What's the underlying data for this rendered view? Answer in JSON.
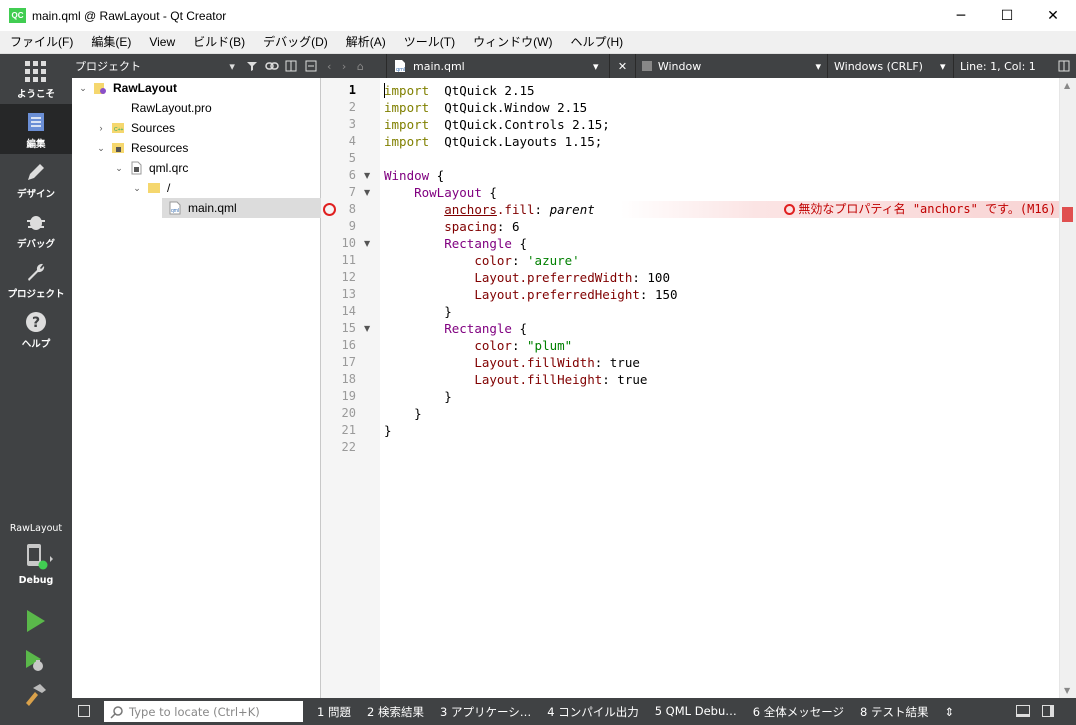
{
  "window": {
    "logo": "QC",
    "title": "main.qml @ RawLayout - Qt Creator",
    "controls": [
      "─",
      "☐",
      "✕"
    ]
  },
  "menu": [
    "ファイル(F)",
    "編集(E)",
    "View",
    "ビルド(B)",
    "デバッグ(D)",
    "解析(A)",
    "ツール(T)",
    "ウィンドウ(W)",
    "ヘルプ(H)"
  ],
  "modes": [
    {
      "label": "ようこそ",
      "icon": "grid-icon"
    },
    {
      "label": "編集",
      "icon": "document-icon",
      "active": true
    },
    {
      "label": "デザイン",
      "icon": "pen-icon"
    },
    {
      "label": "デバッグ",
      "icon": "bug-icon"
    },
    {
      "label": "プロジェクト",
      "icon": "wrench-icon"
    },
    {
      "label": "ヘルプ",
      "icon": "help-icon"
    }
  ],
  "kit": {
    "project": "RawLayout",
    "config": "Debug"
  },
  "project_panel": {
    "title": "プロジェクト"
  },
  "tree": [
    {
      "label": "RawLayout",
      "depth": 0,
      "arrow": "⌄",
      "icon": "project-icon",
      "bold": true
    },
    {
      "label": "RawLayout.pro",
      "depth": 1,
      "arrow": "",
      "icon": "pro-file-icon"
    },
    {
      "label": "Sources",
      "depth": 1,
      "arrow": "›",
      "icon": "sources-folder-icon"
    },
    {
      "label": "Resources",
      "depth": 1,
      "arrow": "⌄",
      "icon": "resources-folder-icon"
    },
    {
      "label": "qml.qrc",
      "depth": 2,
      "arrow": "⌄",
      "icon": "qrc-file-icon"
    },
    {
      "label": "/",
      "depth": 3,
      "arrow": "⌄",
      "icon": "folder-icon"
    },
    {
      "label": "main.qml",
      "depth": 4,
      "arrow": "",
      "icon": "qml-file-icon",
      "selected": true
    }
  ],
  "editor_header": {
    "file": "main.qml",
    "symbol": "Window",
    "line_ending": "Windows (CRLF)",
    "position": "Line: 1, Col: 1"
  },
  "editor": {
    "current_line": 1,
    "fold_lines": [
      6,
      7,
      10,
      15
    ],
    "error_line": 8,
    "error_message": "無効なプロパティ名 \"anchors\" です。(M16)",
    "lines": [
      [
        [
          "kw",
          "import"
        ],
        [
          "",
          "  QtQuick 2.15"
        ]
      ],
      [
        [
          "kw",
          "import"
        ],
        [
          "",
          "  QtQuick.Window 2.15"
        ]
      ],
      [
        [
          "kw",
          "import"
        ],
        [
          "",
          "  QtQuick.Controls 2.15;"
        ]
      ],
      [
        [
          "kw",
          "import"
        ],
        [
          "",
          "  QtQuick.Layouts 1.15;"
        ]
      ],
      [],
      [
        [
          "type",
          "Window"
        ],
        [
          "",
          " {"
        ]
      ],
      [
        [
          "",
          "    "
        ],
        [
          "type",
          "RowLayout"
        ],
        [
          "",
          " {"
        ]
      ],
      [
        [
          "",
          "        "
        ],
        [
          "prop-u",
          "anchors"
        ],
        [
          "prop",
          ".fill"
        ],
        [
          "",
          ": "
        ],
        [
          "it",
          "parent"
        ]
      ],
      [
        [
          "",
          "        "
        ],
        [
          "prop",
          "spacing"
        ],
        [
          "",
          ": 6"
        ]
      ],
      [
        [
          "",
          "        "
        ],
        [
          "type",
          "Rectangle"
        ],
        [
          "",
          " {"
        ]
      ],
      [
        [
          "",
          "            "
        ],
        [
          "prop",
          "color"
        ],
        [
          "",
          ": "
        ],
        [
          "str",
          "'azure'"
        ]
      ],
      [
        [
          "",
          "            "
        ],
        [
          "prop",
          "Layout.preferredWidth"
        ],
        [
          "",
          ": 100"
        ]
      ],
      [
        [
          "",
          "            "
        ],
        [
          "prop",
          "Layout.preferredHeight"
        ],
        [
          "",
          ": 150"
        ]
      ],
      [
        [
          "",
          "        }"
        ]
      ],
      [
        [
          "",
          "        "
        ],
        [
          "type",
          "Rectangle"
        ],
        [
          "",
          " {"
        ]
      ],
      [
        [
          "",
          "            "
        ],
        [
          "prop",
          "color"
        ],
        [
          "",
          ": "
        ],
        [
          "str",
          "\"plum\""
        ]
      ],
      [
        [
          "",
          "            "
        ],
        [
          "prop",
          "Layout.fillWidth"
        ],
        [
          "",
          ": true"
        ]
      ],
      [
        [
          "",
          "            "
        ],
        [
          "prop",
          "Layout.fillHeight"
        ],
        [
          "",
          ": true"
        ]
      ],
      [
        [
          "",
          "        }"
        ]
      ],
      [
        [
          "",
          "    }"
        ]
      ],
      [
        [
          "",
          "}"
        ]
      ],
      []
    ]
  },
  "bottom": {
    "locate_placeholder": "Type to locate (Ctrl+K)",
    "panes": [
      "1  問題",
      "2  検索結果",
      "3  アプリケーシ…",
      "4  コンパイル出力",
      "5  QML Debu…",
      "6  全体メッセージ",
      "8  テスト結果"
    ]
  },
  "colors": {
    "mode_bar": "#404244",
    "active_mode": "#262728",
    "keyword": "#808000",
    "type": "#800080",
    "property": "#800000",
    "string": "#008000",
    "error": "#e02020"
  }
}
